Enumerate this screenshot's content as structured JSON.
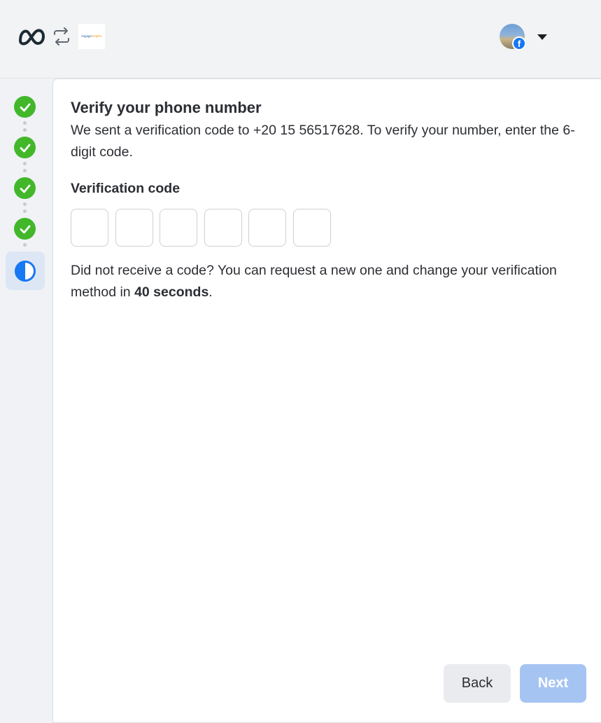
{
  "header": {
    "brand_logo_text_1": "engage",
    "brand_logo_text_2": "Graphic",
    "icons": [
      "meta-logo-icon",
      "swap-icon",
      "caret-down-icon",
      "facebook-icon"
    ]
  },
  "stepper": {
    "completed_steps": 4,
    "current_step": 5,
    "colors": {
      "done": "#42b72a",
      "current": "#1877f2"
    }
  },
  "main": {
    "title": "Verify your phone number",
    "description": "We sent a verification code to +20 15 56517628. To verify your number, enter the 6-digit code.",
    "code_label": "Verification code",
    "code_digits": [
      "",
      "",
      "",
      "",
      "",
      ""
    ],
    "resend_prefix": "Did not receive a code? You can request a new one and change your verification method in ",
    "resend_time": "40 seconds",
    "resend_suffix": "."
  },
  "footer": {
    "back_label": "Back",
    "next_label": "Next"
  },
  "colors": {
    "next_disabled": "#a6c4f2",
    "back_bg": "#e9ebee"
  }
}
